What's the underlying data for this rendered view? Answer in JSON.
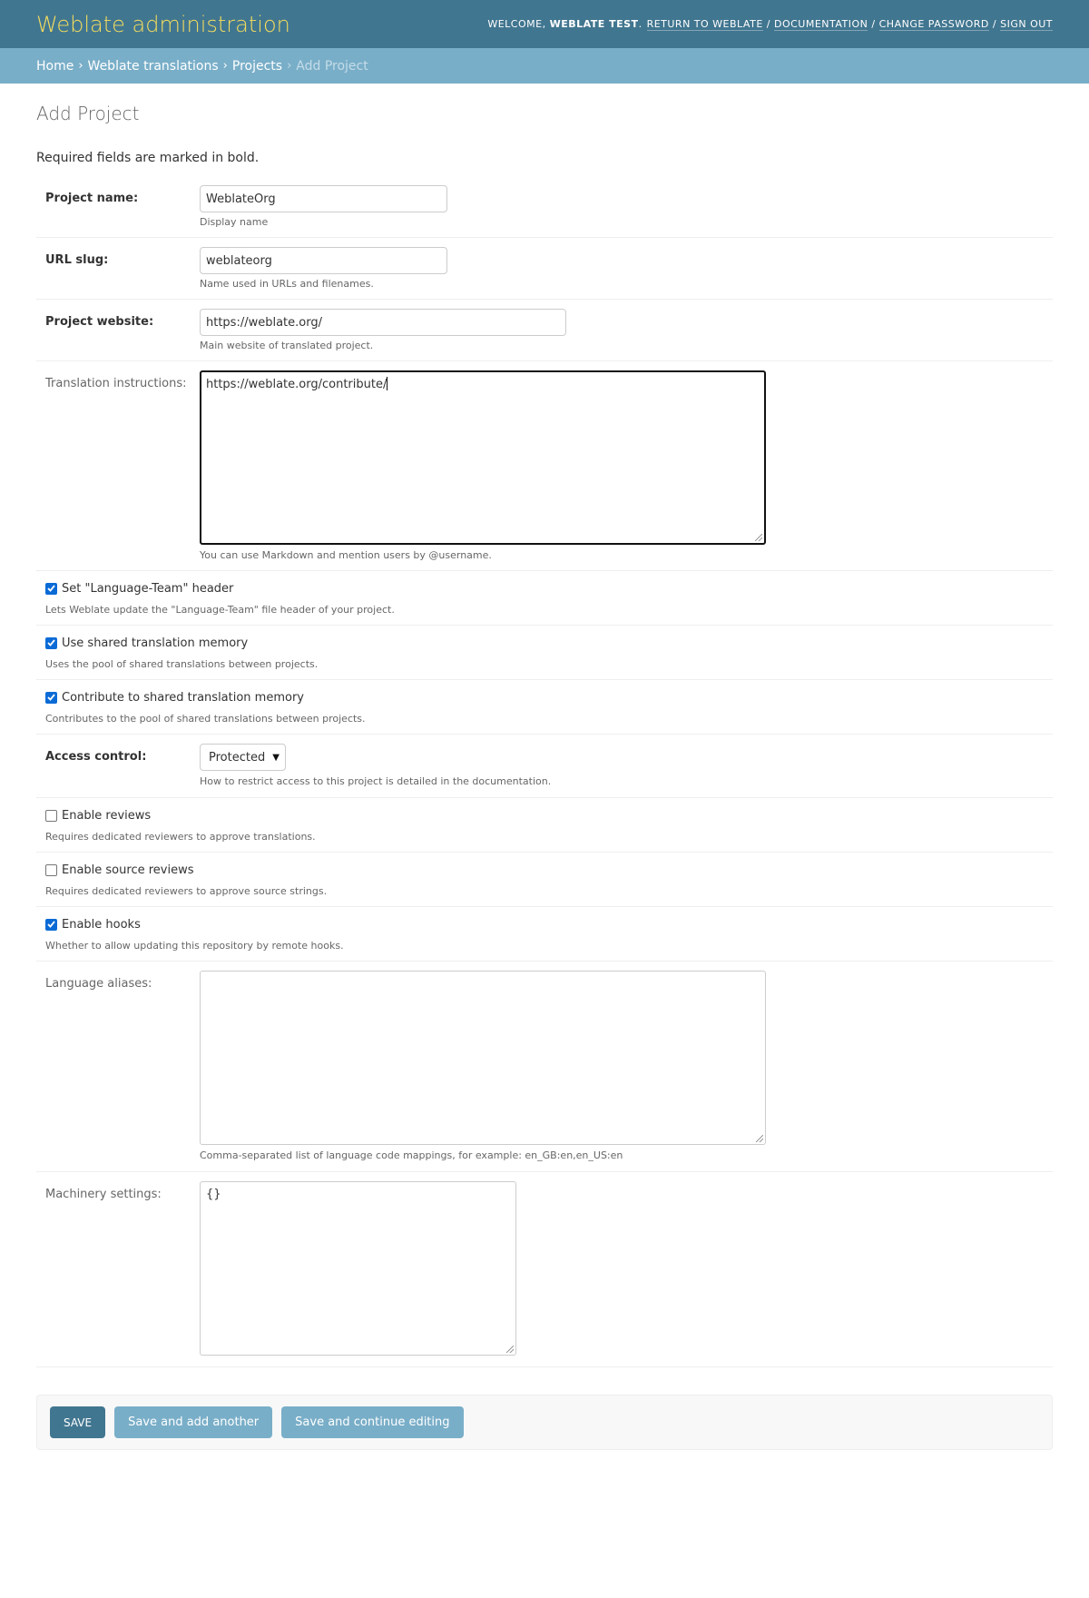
{
  "header": {
    "title": "Weblate administration",
    "welcome": "Welcome,",
    "username": "Weblate test",
    "links": [
      "Return to Weblate",
      "Documentation",
      "Change password",
      "Sign out"
    ]
  },
  "breadcrumbs": {
    "items": [
      "Home",
      "Weblate translations",
      "Projects"
    ],
    "current": "Add Project"
  },
  "page": {
    "title": "Add Project",
    "required_note": "Required fields are marked in bold."
  },
  "form": {
    "project_name": {
      "label": "Project name:",
      "value": "WeblateOrg",
      "help": "Display name"
    },
    "url_slug": {
      "label": "URL slug:",
      "value": "weblateorg",
      "help": "Name used in URLs and filenames."
    },
    "project_website": {
      "label": "Project website:",
      "value": "https://weblate.org/",
      "help": "Main website of translated project."
    },
    "instructions": {
      "label": "Translation instructions:",
      "value": "https://weblate.org/contribute/",
      "help": "You can use Markdown and mention users by @username."
    },
    "set_language_team": {
      "label": "Set \"Language-Team\" header",
      "checked": true,
      "help": "Lets Weblate update the \"Language-Team\" file header of your project."
    },
    "use_shared_tm": {
      "label": "Use shared translation memory",
      "checked": true,
      "help": "Uses the pool of shared translations between projects."
    },
    "contribute_shared_tm": {
      "label": "Contribute to shared translation memory",
      "checked": true,
      "help": "Contributes to the pool of shared translations between projects."
    },
    "access_control": {
      "label": "Access control:",
      "value": "Protected",
      "help": "How to restrict access to this project is detailed in the documentation."
    },
    "enable_reviews": {
      "label": "Enable reviews",
      "checked": false,
      "help": "Requires dedicated reviewers to approve translations."
    },
    "enable_source_reviews": {
      "label": "Enable source reviews",
      "checked": false,
      "help": "Requires dedicated reviewers to approve source strings."
    },
    "enable_hooks": {
      "label": "Enable hooks",
      "checked": true,
      "help": "Whether to allow updating this repository by remote hooks."
    },
    "language_aliases": {
      "label": "Language aliases:",
      "value": "",
      "help": "Comma-separated list of language code mappings, for example: en_GB:en,en_US:en"
    },
    "machinery_settings": {
      "label": "Machinery settings:",
      "value": "{}",
      "help": ""
    }
  },
  "buttons": {
    "save": "Save",
    "save_add_another": "Save and add another",
    "save_continue": "Save and continue editing"
  },
  "colors": {
    "header_bg": "#417690",
    "breadcrumb_bg": "#79aec8",
    "branding": "#f5dd5d",
    "checkbox_accent": "#0b6bd6"
  }
}
